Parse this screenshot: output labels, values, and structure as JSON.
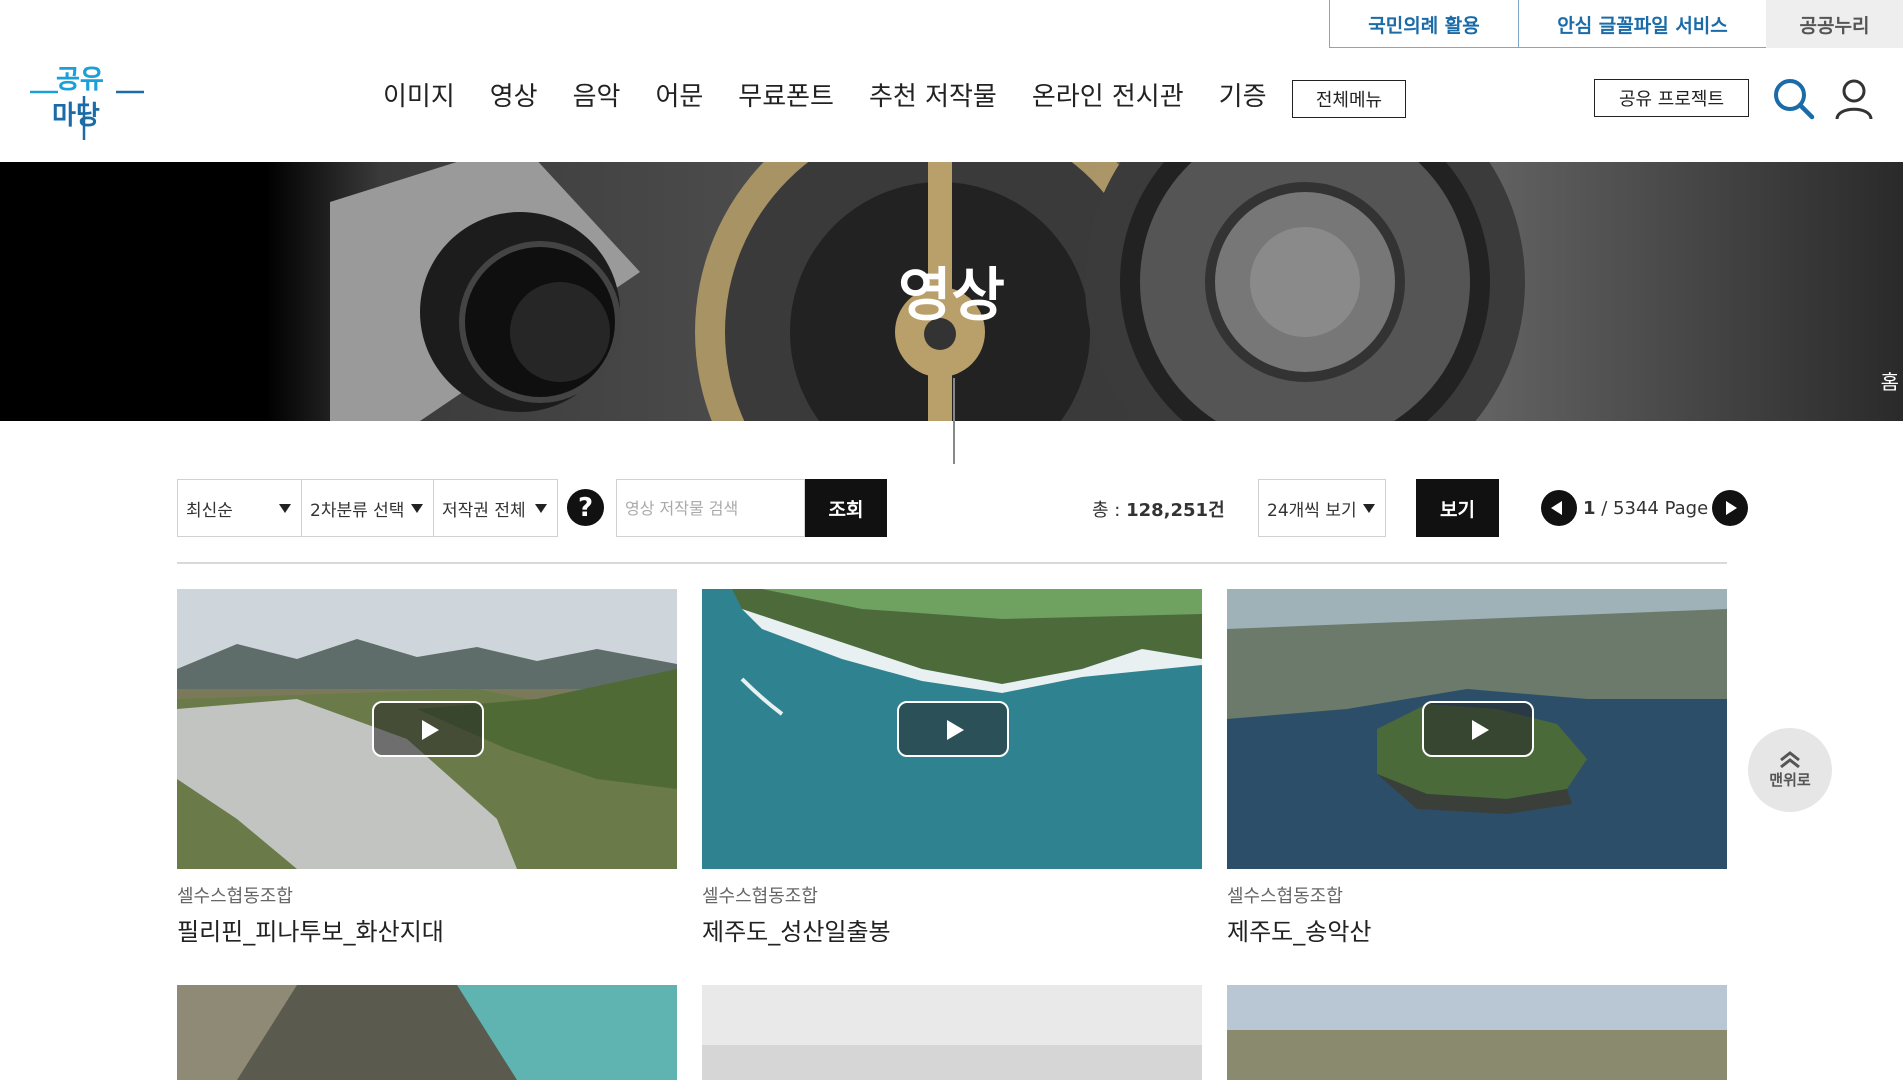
{
  "util_links": [
    "국민의례 활용",
    "안심 글꼴파일 서비스",
    "공공누리"
  ],
  "logo": {
    "top": "공유",
    "bottom": "마당"
  },
  "gnb": [
    "이미지",
    "영상",
    "음악",
    "어문",
    "무료폰트",
    "추천 저작물",
    "온라인 전시관",
    "기증"
  ],
  "all_menu_label": "전체메뉴",
  "project_label": "공유 프로젝트",
  "banner": {
    "title": "영상",
    "side_text": "홈"
  },
  "filters": {
    "sort": "최신순",
    "category": "2차분류 선택",
    "copyright": "저작권 전체",
    "help": "?",
    "search_placeholder": "영상 저작물 검색",
    "search_button": "조회",
    "total_label": "총 : ",
    "total_value": "128,251건",
    "per_page": "24개씩 보기",
    "view_button": "보기",
    "page_current": "1",
    "page_rest": " / 5344 Page"
  },
  "cards": [
    {
      "org": "셀수스협동조합",
      "title": "필리핀_피나투보_화산지대"
    },
    {
      "org": "셀수스협동조합",
      "title": "제주도_성산일출봉"
    },
    {
      "org": "셀수스협동조합",
      "title": "제주도_송악산"
    }
  ],
  "top_button": "맨위로",
  "colors": {
    "accent": "#1a6ba8",
    "logo_blue": "#1aa0d8",
    "dark_button": "#111111"
  }
}
